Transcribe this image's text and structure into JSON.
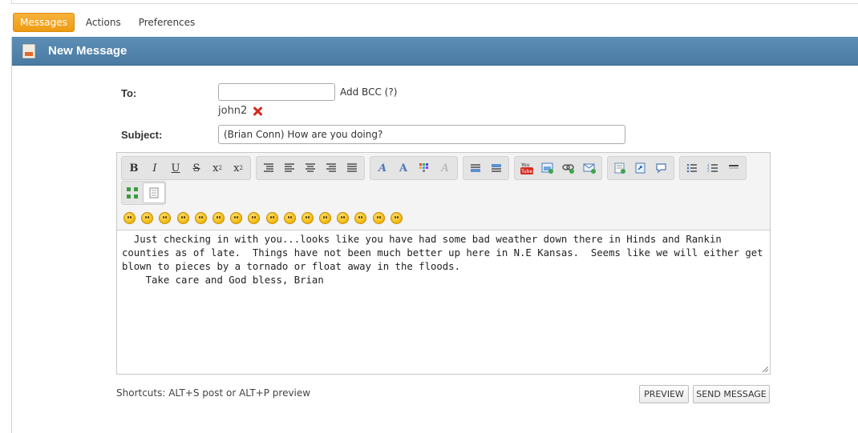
{
  "tabs": [
    "Messages",
    "Actions",
    "Preferences"
  ],
  "panel": {
    "title": "New Message"
  },
  "form": {
    "to_label": "To:",
    "to_value": "",
    "add_bcc": "Add BCC (?)",
    "recipient": "john2",
    "subject_label": "Subject:",
    "subject_value": "(Brian Conn) How are you doing?"
  },
  "editor": {
    "toolbar_row1": [
      [
        "bold",
        "italic",
        "underline",
        "strikethrough",
        "superscript",
        "subscript"
      ],
      [
        "outdent",
        "align-left",
        "align-center",
        "align-right",
        "justify"
      ],
      [
        "font",
        "font-size",
        "text-color",
        "remove-format"
      ],
      [
        "horizontal-rule",
        "table"
      ],
      [
        "youtube",
        "image",
        "link",
        "email"
      ],
      [
        "insert-code",
        "quote",
        "comment"
      ],
      [
        "bullet-list",
        "numbered-list",
        "horizontal-line"
      ]
    ],
    "toolbar_row2": [
      "maximize",
      "source"
    ],
    "emoticons": [
      "smile",
      "wink",
      "happy",
      "grin",
      "angry",
      "sad",
      "shocked",
      "cool",
      "confused",
      "rolleyes",
      "tongue",
      "cry",
      "mad",
      "smug",
      "laugh",
      "sick"
    ],
    "content": "  Just checking in with you...looks like you have had some bad weather down there in Hinds and Rankin counties as of late.  Things have not been much better up here in N.E Kansas.  Seems like we will either get blown to pieces by a tornado or float away in the floods.\n    Take care and God bless, Brian"
  },
  "footer": {
    "shortcuts": "Shortcuts: ALT+S post or ALT+P preview",
    "preview_label": "PREVIEW",
    "send_label": "SEND MESSAGE"
  },
  "colors": {
    "accent": "#f0a020",
    "header": "#4f7fa8"
  }
}
